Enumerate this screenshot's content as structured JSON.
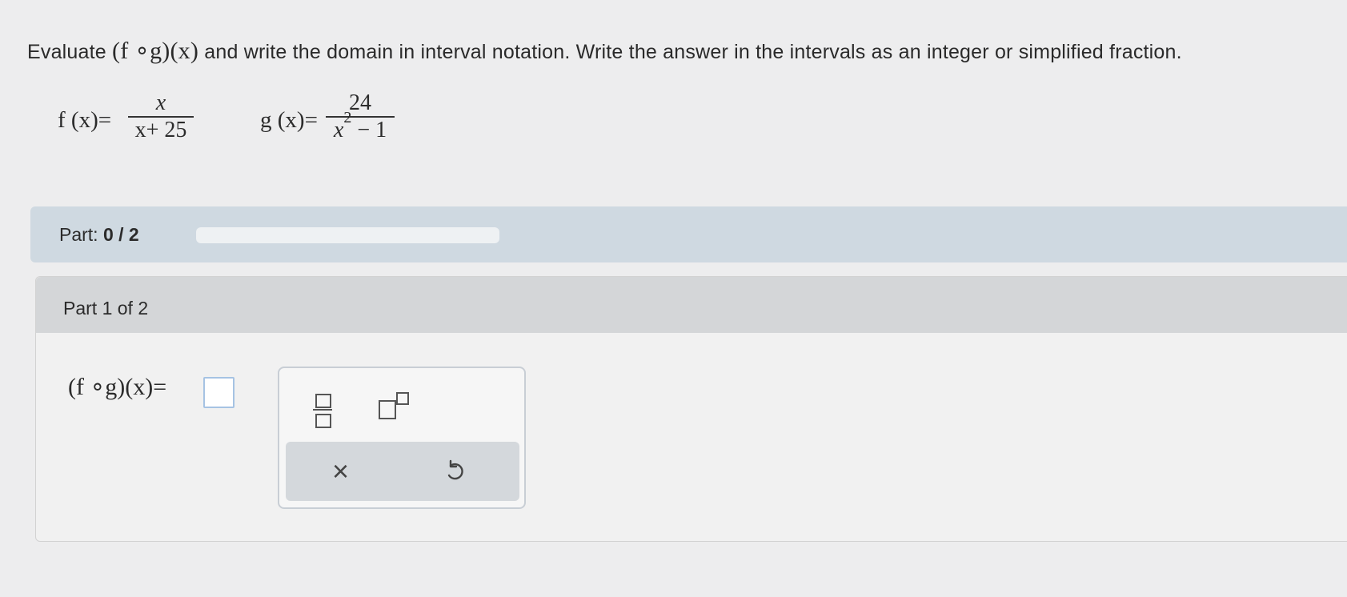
{
  "prompt": {
    "lead": "Evaluate",
    "expr": "(f ∘g)(x)",
    "rest": "and write the domain in interval notation. Write the answer in the intervals as an integer or simplified fraction."
  },
  "functions": {
    "f": {
      "lhs": "f (x)=",
      "numerator": "x",
      "denominator": "x+ 25"
    },
    "g": {
      "lhs": "g (x)=",
      "numerator": "24",
      "denominator_base": "x",
      "denominator_exp": "2",
      "denominator_rest": " − 1"
    }
  },
  "progress": {
    "label": "Part:",
    "value_text": "0 / 2",
    "fraction_complete": 0
  },
  "part": {
    "title": "Part 1 of 2",
    "equation_lhs": "(f ∘g)(x)=",
    "answer_value": ""
  },
  "palette": {
    "fraction_icon": "fraction-icon",
    "exponent_icon": "exponent-icon",
    "clear_icon": "close-icon",
    "clear_glyph": "×",
    "undo_icon": "undo-icon"
  },
  "colors": {
    "progress_bg": "#cfd9e1",
    "answer_border": "#a6c3e3",
    "header_bg": "#d4d6d8"
  }
}
